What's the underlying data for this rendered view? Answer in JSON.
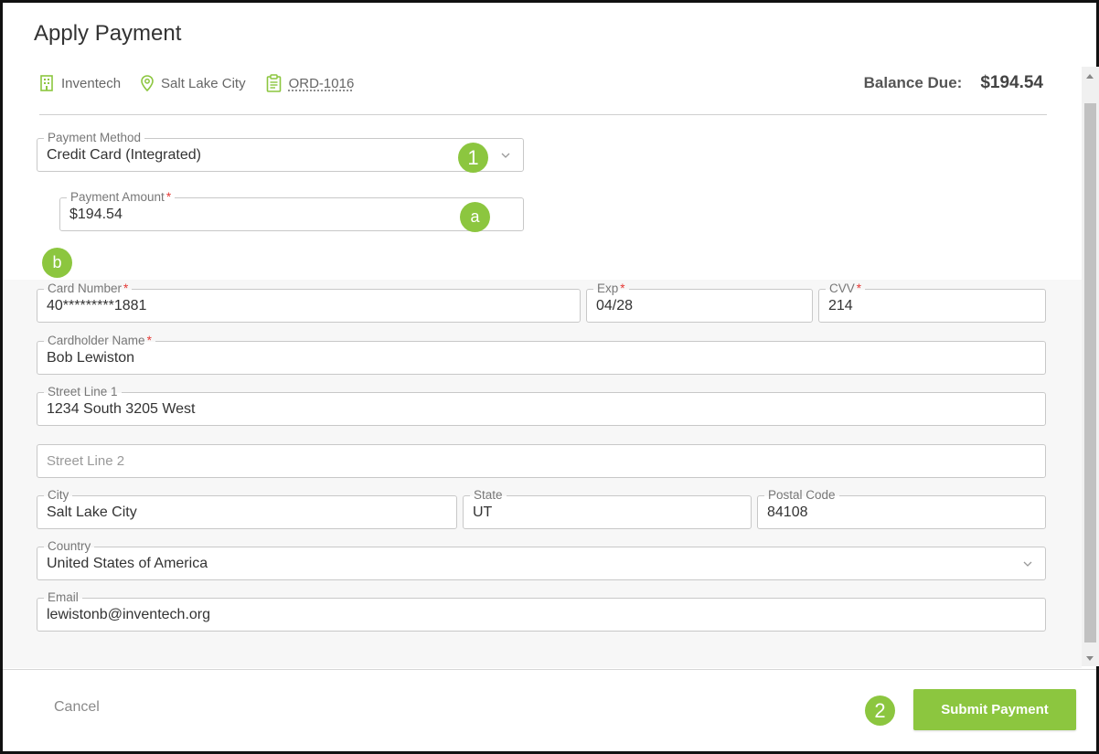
{
  "dialog": {
    "title": "Apply Payment",
    "company": "Inventech",
    "location": "Salt Lake City",
    "order": "ORD-1016",
    "balance_label": "Balance Due:",
    "balance_value": "$194.54"
  },
  "payment": {
    "method_label": "Payment Method",
    "method_value": "Credit Card (Integrated)",
    "amount_label": "Payment Amount",
    "amount_value": "$194.54"
  },
  "card": {
    "number_label": "Card Number",
    "number_value": "40*********1881",
    "exp_label": "Exp",
    "exp_value": "04/28",
    "cvv_label": "CVV",
    "cvv_value": "214",
    "name_label": "Cardholder Name",
    "name_value": "Bob Lewiston",
    "street1_label": "Street Line 1",
    "street1_value": "1234 South 3205 West",
    "street2_placeholder": "Street Line 2",
    "city_label": "City",
    "city_value": "Salt Lake City",
    "state_label": "State",
    "state_value": "UT",
    "postal_label": "Postal Code",
    "postal_value": "84108",
    "country_label": "Country",
    "country_value": "United States of America",
    "email_label": "Email",
    "email_value": "lewistonb@inventech.org",
    "required_mark": "*"
  },
  "badges": {
    "step1": "1",
    "step_a": "a",
    "step_b": "b",
    "step2": "2"
  },
  "footer": {
    "cancel_label": "Cancel",
    "submit_label": "Submit Payment"
  },
  "colors": {
    "accent": "#8cc63f",
    "required": "#e53935"
  }
}
